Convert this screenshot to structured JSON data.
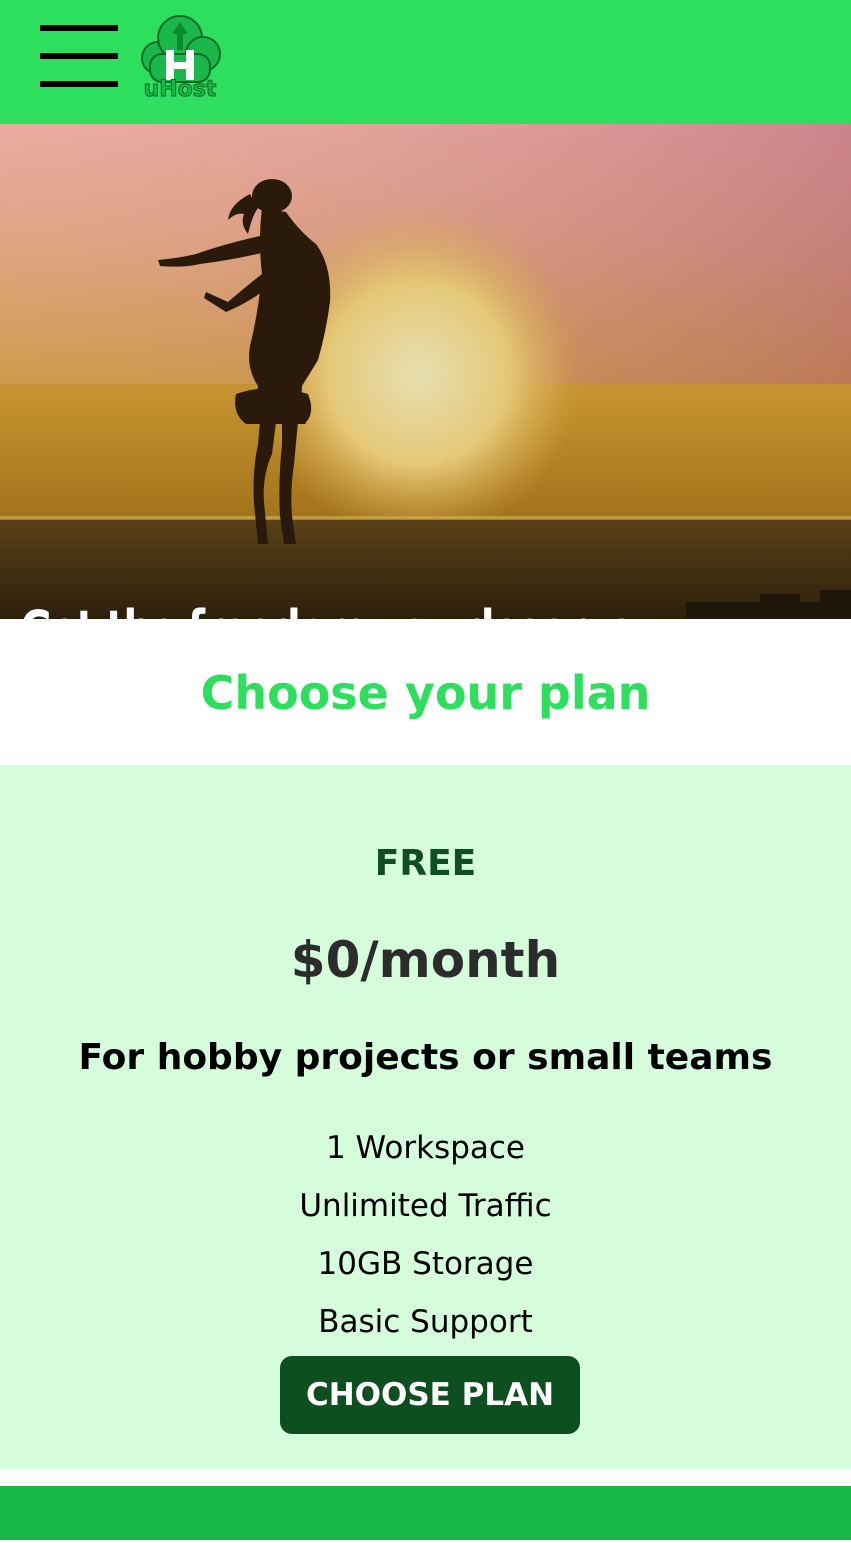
{
  "header": {
    "menu_icon": "hamburger-menu-icon",
    "logo_text": "uHost",
    "logo_icon": "cloud-upload-icon",
    "background_color": "#2ddf5c"
  },
  "hero": {
    "headline": "Get the freedom you deserve",
    "image_subject": "woman silhouette at sunset by the sea"
  },
  "plans_section": {
    "title": "Choose your plan",
    "title_color": "#2ddf5c"
  },
  "plan": {
    "name": "FREE",
    "price": "$0/month",
    "description": "For hobby projects or small teams",
    "features": [
      "1 Workspace",
      "Unlimited Traffic",
      "10GB Storage",
      "Basic Support"
    ],
    "button_label": "CHOOSE PLAN",
    "background_color": "#d5fddc",
    "button_color": "#0e4f1f"
  },
  "footer": {
    "background_color": "#1ab84a"
  }
}
